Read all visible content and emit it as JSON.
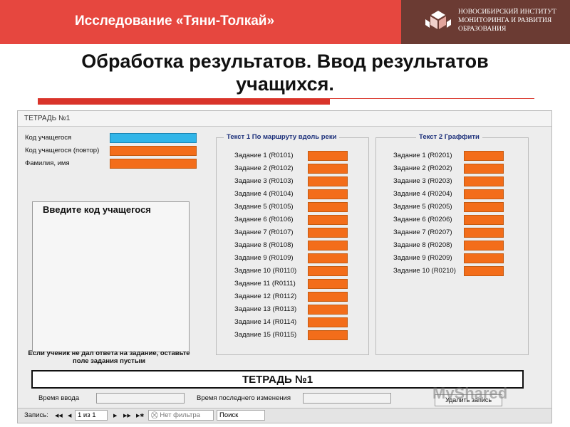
{
  "banner": {
    "title": "Исследование «Тяни-Толкай»",
    "logo_lines": [
      "Новосибирский институт",
      "мониторинга и развития",
      "образования"
    ]
  },
  "slide_title_line1": "Обработка результатов. Ввод результатов",
  "slide_title_line2": "учащихся.",
  "form": {
    "header": "ТЕТРАДЬ №1",
    "fields": {
      "student_code": "Код учащегося",
      "student_code_repeat": "Код учащегося (повтор)",
      "full_name": "Фамилия, имя"
    },
    "code_prompt": "Введите код учащегося",
    "note": "Если ученик не дал ответа на задание, оставьте поле задания пустым",
    "text1": {
      "title": "Текст 1 По маршруту вдоль реки",
      "tasks": [
        "Задание 1 (R0101)",
        "Задание 2 (R0102)",
        "Задание 3 (R0103)",
        "Задание 4 (R0104)",
        "Задание 5 (R0105)",
        "Задание 6 (R0106)",
        "Задание 7 (R0107)",
        "Задание 8 (R0108)",
        "Задание 9 (R0109)",
        "Задание 10 (R0110)",
        "Задание 11 (R0111)",
        "Задание 12 (R0112)",
        "Задание 13 (R0113)",
        "Задание 14 (R0114)",
        "Задание 15 (R0115)"
      ]
    },
    "text2": {
      "title": "Текст 2 Граффити",
      "tasks": [
        "Задание 1 (R0201)",
        "Задание 2 (R0202)",
        "Задание 3 (R0203)",
        "Задание 4 (R0204)",
        "Задание 5 (R0205)",
        "Задание 6 (R0206)",
        "Задание 7 (R0207)",
        "Задание 8 (R0208)",
        "Задание 9 (R0209)",
        "Задание 10 (R0210)"
      ]
    },
    "tetrad_banner": "ТЕТРАДЬ №1",
    "entry_time_label": "Время ввода",
    "last_change_label": "Время последнего изменения",
    "delete_button": "Удалить запись",
    "statusbar": {
      "records_label": "Запись:",
      "first": "◀◀",
      "prev": "◀",
      "position": "1 из 1",
      "next": "▶",
      "last": "▶▶",
      "new": "▶✱",
      "filter": "Нет фильтра",
      "search": "Поиск"
    }
  },
  "watermark": "MyShared",
  "colors": {
    "banner_red": "#e6473f",
    "logo_bg": "#6b3b33",
    "field_orange": "#f36d1a",
    "field_blue": "#31b5e8"
  }
}
